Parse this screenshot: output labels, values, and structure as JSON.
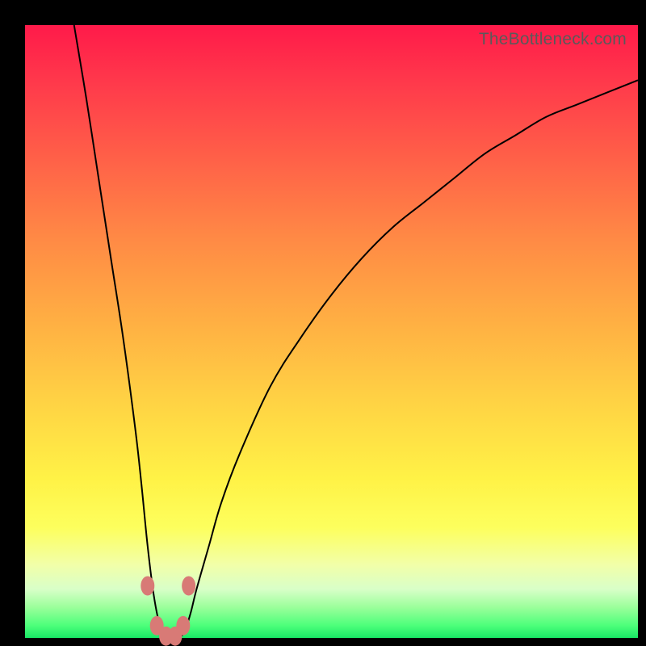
{
  "watermark": "TheBottleneck.com",
  "colors": {
    "frame": "#000000",
    "curve": "#000000",
    "marker": "#d87a76",
    "gradient_top": "#ff1a4a",
    "gradient_bottom": "#18e765"
  },
  "chart_data": {
    "type": "line",
    "title": "",
    "xlabel": "",
    "ylabel": "",
    "xlim": [
      0,
      100
    ],
    "ylim": [
      0,
      100
    ],
    "grid": false,
    "x": [
      8,
      10,
      12,
      14,
      16,
      18,
      19,
      20,
      21,
      22,
      23,
      24,
      25,
      26,
      27,
      28,
      30,
      32,
      35,
      40,
      45,
      50,
      55,
      60,
      65,
      70,
      75,
      80,
      85,
      90,
      95,
      100
    ],
    "y": [
      100,
      88,
      75,
      62,
      49,
      34,
      25,
      15,
      7,
      2,
      0,
      0,
      0,
      1,
      4,
      8,
      15,
      22,
      30,
      41,
      49,
      56,
      62,
      67,
      71,
      75,
      79,
      82,
      85,
      87,
      89,
      91
    ],
    "markers": {
      "x": [
        20.0,
        21.5,
        23.0,
        24.5,
        25.8,
        26.7
      ],
      "y": [
        8.5,
        2.0,
        0.3,
        0.3,
        2.0,
        8.5
      ]
    }
  }
}
